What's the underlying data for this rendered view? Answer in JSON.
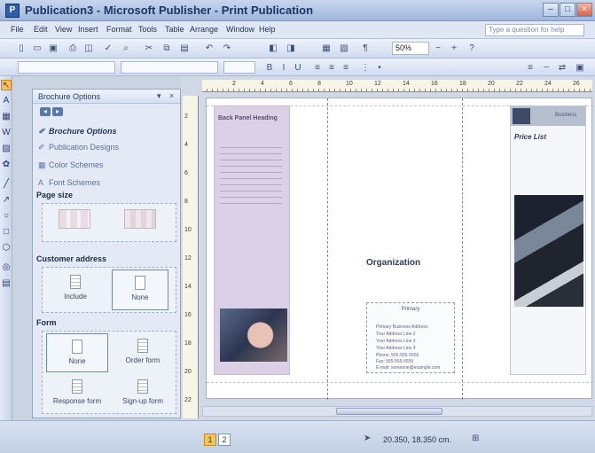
{
  "window": {
    "title": "Publication3 - Microsoft Publisher - Print Publication",
    "icon": "publisher-icon"
  },
  "menu": {
    "items": [
      "File",
      "Edit",
      "View",
      "Insert",
      "Format",
      "Tools",
      "Table",
      "Arrange",
      "Window",
      "Help"
    ],
    "help_placeholder": "Type a question for help"
  },
  "toolbar": {
    "zoom": "50%"
  },
  "task_pane": {
    "title": "Brochure Options",
    "links": [
      "Brochure Options",
      "Publication Designs",
      "Color Schemes",
      "Font Schemes"
    ],
    "page_size_label": "Page size",
    "customer_address_label": "Customer address",
    "address_options": [
      "Include",
      "None"
    ],
    "form_label": "Form",
    "form_options": [
      "None",
      "Order form",
      "Response form",
      "Sign-up form"
    ]
  },
  "document": {
    "back_panel_heading": "Back Panel Heading",
    "organization": "Organization",
    "address_heading": "Primary",
    "address_lines": [
      "Primary Business Address",
      "Your Address Line 2",
      "Your Address Line 3",
      "Your Address Line 4",
      "Phone: 555-555-5555",
      "Fax: 555-555-5555",
      "E-mail: someone@example.com"
    ],
    "right_title": "Price List",
    "right_label": "Business"
  },
  "ruler": {
    "h_numbers": [
      "2",
      "4",
      "6",
      "8",
      "10",
      "12",
      "14",
      "16",
      "18",
      "20",
      "22",
      "24",
      "26"
    ],
    "v_numbers": [
      "2",
      "4",
      "6",
      "8",
      "10",
      "12",
      "14",
      "16",
      "18",
      "20",
      "22"
    ]
  },
  "status": {
    "pages": [
      "1",
      "2"
    ],
    "position": "20.350, 18.350 cm."
  },
  "colors": {
    "accent": "#f5c35a",
    "panel_purple": "#dcd0e6",
    "titlebar": "#9fb6dc"
  }
}
